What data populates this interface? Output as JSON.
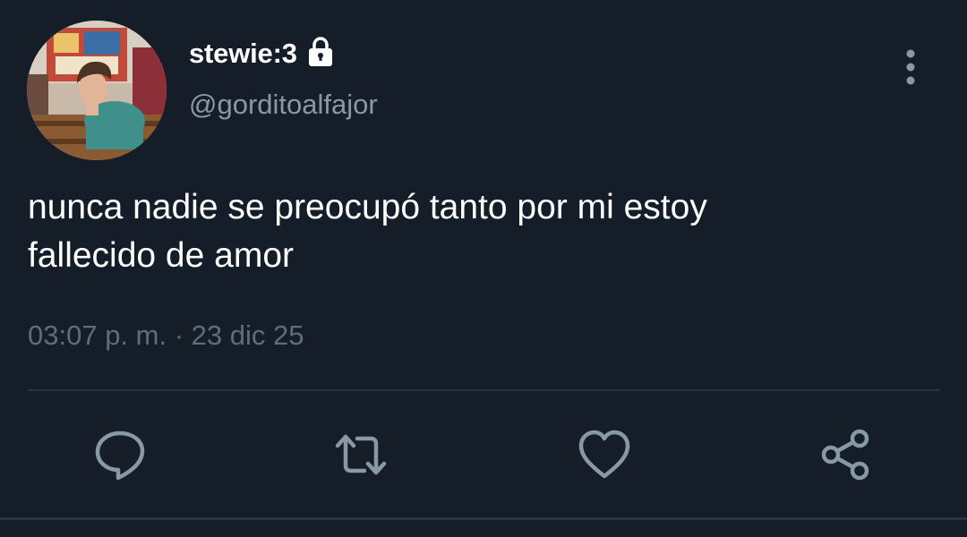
{
  "user": {
    "display_name": "stewie:3",
    "handle": "@gorditoalfajor",
    "protected_icon": "lock-icon"
  },
  "tweet": {
    "text": "nunca nadie se preocupó tanto por mi estoy\nfallecido de amor",
    "timestamp": "03:07 p. m. · 23 dic 25"
  },
  "actions": [
    {
      "name": "reply",
      "icon": "comment-icon"
    },
    {
      "name": "retweet",
      "icon": "retweet-icon"
    },
    {
      "name": "like",
      "icon": "heart-icon"
    },
    {
      "name": "share",
      "icon": "share-icon"
    }
  ],
  "menu_icon": "more-vertical-icon",
  "colors": {
    "background": "#151d28",
    "primary_text": "#ffffff",
    "secondary_text": "#8899a6",
    "timestamp_text": "#5c6e7e",
    "icon": "#8899a6",
    "divider": "#263340"
  }
}
